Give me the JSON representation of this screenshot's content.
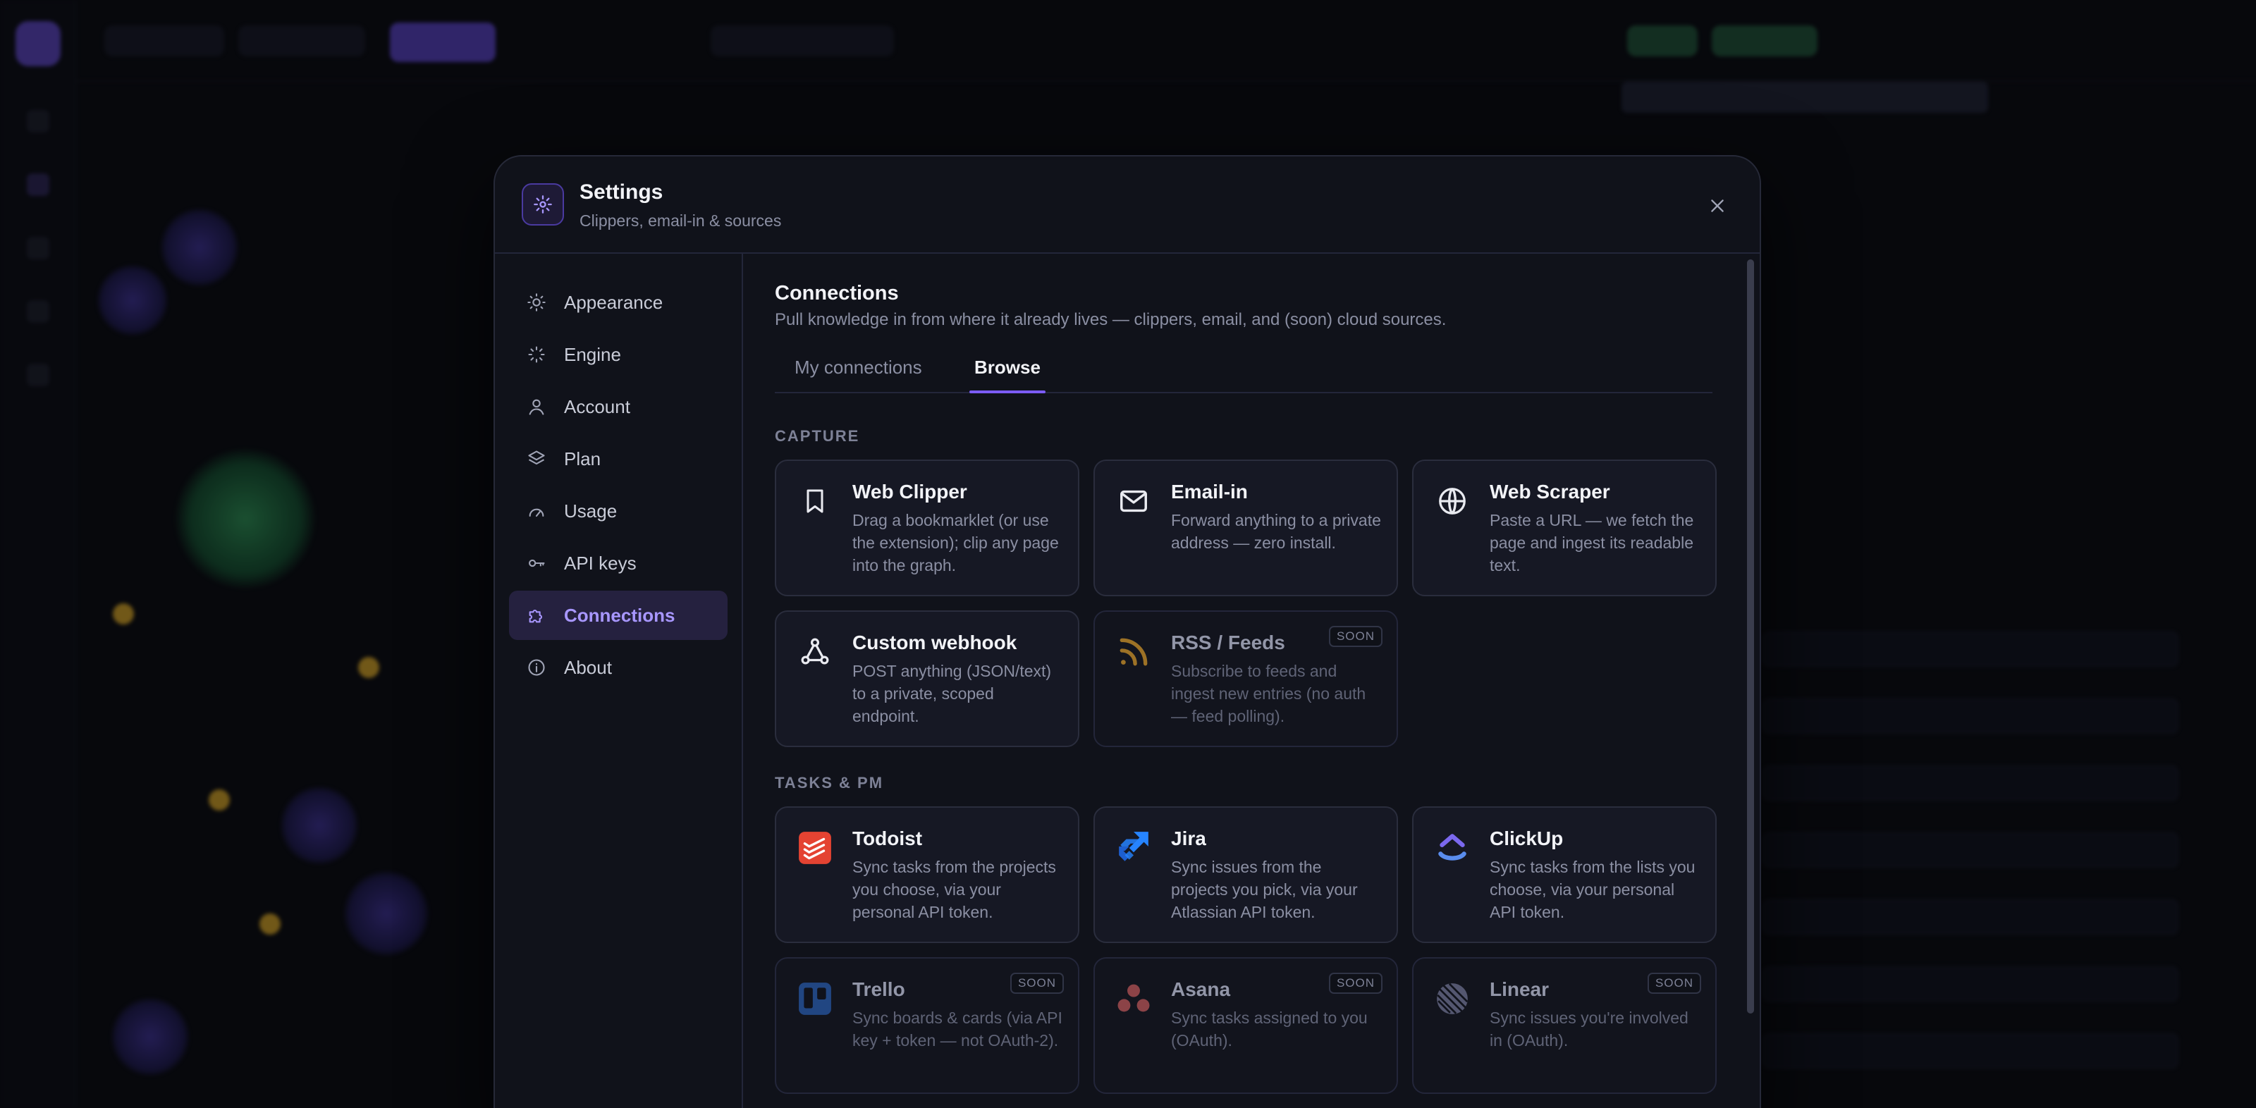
{
  "modal": {
    "title": "Settings",
    "subtitle": "Clippers, email-in & sources"
  },
  "sidebar": {
    "items": [
      {
        "label": "Appearance",
        "icon": "sun-icon"
      },
      {
        "label": "Engine",
        "icon": "loader-icon"
      },
      {
        "label": "Account",
        "icon": "user-icon"
      },
      {
        "label": "Plan",
        "icon": "layers-icon"
      },
      {
        "label": "Usage",
        "icon": "gauge-icon"
      },
      {
        "label": "API keys",
        "icon": "key-icon"
      },
      {
        "label": "Connections",
        "icon": "puzzle-icon",
        "active": true
      },
      {
        "label": "About",
        "icon": "info-icon"
      }
    ]
  },
  "content": {
    "title": "Connections",
    "subtitle": "Pull knowledge in from where it already lives — clippers, email, and (soon) cloud sources.",
    "tabs": [
      {
        "label": "My connections"
      },
      {
        "label": "Browse",
        "active": true
      }
    ],
    "sections": [
      {
        "label": "CAPTURE",
        "cards": [
          {
            "title": "Web Clipper",
            "desc": "Drag a bookmarklet (or use the extension); clip any page into the graph.",
            "icon": "bookmark-icon"
          },
          {
            "title": "Email-in",
            "desc": "Forward anything to a private address — zero install.",
            "icon": "mail-icon"
          },
          {
            "title": "Web Scraper",
            "desc": "Paste a URL — we fetch the page and ingest its readable text.",
            "icon": "globe-icon"
          },
          {
            "title": "Custom webhook",
            "desc": "POST anything (JSON/text) to a private, scoped endpoint.",
            "icon": "webhook-icon"
          },
          {
            "title": "RSS / Feeds",
            "desc": "Subscribe to feeds and ingest new entries (no auth — feed polling).",
            "icon": "rss-icon",
            "badge": "SOON"
          }
        ]
      },
      {
        "label": "TASKS & PM",
        "cards": [
          {
            "title": "Todoist",
            "desc": "Sync tasks from the projects you choose, via your personal API token.",
            "icon": "todoist-icon"
          },
          {
            "title": "Jira",
            "desc": "Sync issues from the projects you pick, via your Atlassian API token.",
            "icon": "jira-icon"
          },
          {
            "title": "ClickUp",
            "desc": "Sync tasks from the lists you choose, via your personal API token.",
            "icon": "clickup-icon"
          },
          {
            "title": "Trello",
            "desc": "Sync boards & cards (via API key + token — not OAuth-2).",
            "icon": "trello-icon",
            "badge": "SOON"
          },
          {
            "title": "Asana",
            "desc": "Sync tasks assigned to you (OAuth).",
            "icon": "asana-icon",
            "badge": "SOON"
          },
          {
            "title": "Linear",
            "desc": "Sync issues you're involved in (OAuth).",
            "icon": "linear-icon",
            "badge": "SOON"
          }
        ]
      }
    ]
  },
  "colors": {
    "accent": "#7c5cff",
    "todoist": "#e44332",
    "jira": "#2684ff",
    "clickup": "#7b68ee",
    "trello": "#2f6fd6",
    "asana": "#f06a6a",
    "linear": "#8b8fb5",
    "rss": "#d89a2a"
  }
}
